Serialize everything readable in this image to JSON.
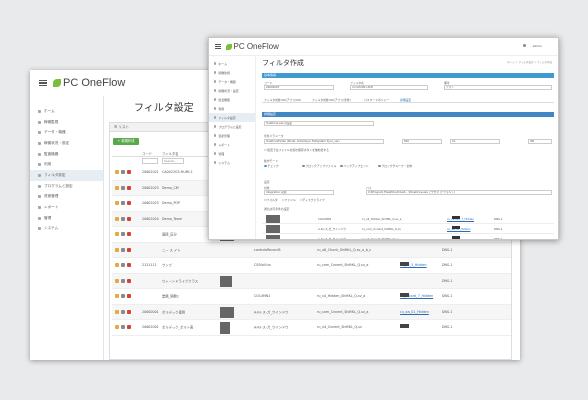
{
  "brand": {
    "name": "PC OneFlow",
    "leaf_color": "#79bf3a",
    "accent": "#3f9bd1",
    "add_button_color": "#59a94b"
  },
  "back": {
    "title": "フィルタ設定",
    "sidebar": [
      "ホーム",
      "稼働監視",
      "データ・機器",
      "稼働状況・設定",
      "監査機器",
      "利用",
      "フィルタ設定",
      "プログラムと設定",
      "資産管理",
      "レポート",
      "管理",
      "システム"
    ],
    "panel_header": "リスト",
    "add_button": "新規作成",
    "columns": [
      "",
      "コード",
      "フィルタ名"
    ],
    "search_placeholder": "Search...",
    "rows": [
      {
        "code": "20602021",
        "name": "CA0023G3-HUMI-1"
      },
      {
        "code": "20602023",
        "name": "Demo_CM"
      },
      {
        "code": "20602023",
        "name": "Demo_POP"
      },
      {
        "code": "20602024",
        "name": "Demo_Team"
      },
      {
        "code": "",
        "name": "面接_区分"
      },
      {
        "code": "",
        "name": "ニー ス イト"
      },
      {
        "code": "2121111",
        "name": "サンプ"
      },
      {
        "code": "",
        "name": "ウィーンドライブクラス"
      },
      {
        "code": "",
        "name": "業務_開発1"
      },
      {
        "code": "20600001",
        "name": "ボルデック運用"
      },
      {
        "code": "20602001",
        "name": "ボルデック_ボルト表"
      }
    ],
    "row_cells": [
      {
        "a": "controlsRecord5",
        "b": "ru_x6_Chunk_ShiftKL_Q.sv_a_b_c",
        "c": "",
        "d": "DNS-1"
      },
      {
        "a": "CSSfoll.ho",
        "b": "ru_com_Cnnent_ShiftKL_Q.sv_a",
        "c": "cu_wt_5_Hidden",
        "d": "DNS-1"
      },
      {
        "a": "",
        "b": "",
        "c": "",
        "d": "DNS-1"
      },
      {
        "a": "COLUMN1",
        "b": "ru_x4_Hidden_ShiftKL_Q.sv_a",
        "c": "cu_record_7_Hidden",
        "d": "DNS-1"
      },
      {
        "a": "A-K-I-ス-ガ_ウインドウ",
        "b": "ru_com_Cnnent_ShiftKL_Q.sv_a",
        "c": "cu_aa_01_Hidden",
        "d": "DNS-1"
      },
      {
        "a": "A-K-I-ス-ガ_ウインドウ",
        "b": "ru_x4_Cnnent_ShiftKL_Q.sv",
        "c": "",
        "d": "DNS-1"
      }
    ]
  },
  "front": {
    "title": "フィルタ作成",
    "breadcrumb": "ホーム > フィルタ設定 > フィルタ作成",
    "user": "admin",
    "sidebar": [
      "ホーム",
      "稼働監視",
      "データ・機器",
      "稼働状況・設定",
      "監査機器",
      "利用",
      "フィルタ設定",
      "プログラムと設定",
      "資産管理",
      "レポート",
      "管理",
      "システム"
    ],
    "section1": "基本情報",
    "fields": [
      {
        "label": "コード",
        "value": "20602023"
      },
      {
        "label": "フィルタ名",
        "value": "cmd-PC001-SUE"
      },
      {
        "label": "備考",
        "value": "テスト"
      }
    ],
    "tabs": [
      "フィルタ対象(OS/アプリ/OS)",
      "フィルタ対象(OS/アプリ/条件)",
      "パスワードポリシー",
      "詳細設定"
    ],
    "section2": "詳細設定",
    "target_value": "OneDrive.exe の設定",
    "sub_label": "条件パラメータ",
    "sub_select": "OneDriveFolder (Mode: ActiveSync FileSystem Sync_ver)",
    "sub_input": "500",
    "sub_input2": "10",
    "sub_select2": "ON",
    "checkbox": "既定ではファイルを開き保存ボタンを無効化する",
    "radios_label": "動作モード",
    "radios": [
      "チェック",
      "ブロックアップファイル",
      "バックアップエンド",
      "ブロックグループ・全体"
    ],
    "section3": "設定",
    "item_label": "対象",
    "item_select": "Integration 初期",
    "path_label": "パス",
    "path_value": "C:¥Program Files¥OneDrive¥... ¥OneDrive.exe アクセス (デフォルト)",
    "checks": [
      "フォルダ",
      "ファイル",
      "ディスクドライブ"
    ],
    "result_header": "通信許可条件の設定",
    "rows": [
      {
        "a": "COLUMN1",
        "b": "ru_x4_Hidden_ShiftKL_Q.sv_a",
        "c": "cu_record_7_Hidden",
        "d": "DNS-1"
      },
      {
        "a": "A-K-I-ス-ガ_ウインドウ",
        "b": "ru_com_Cnnent_ShiftKL_Q.sv",
        "c": "cu_aa_01_Hidden",
        "d": "DNS-1"
      },
      {
        "a": "A-K-I-ス-ガ_ウインドウ",
        "b": "ru_x4_Cnnent_ShiftKL_Q.sv",
        "c": "",
        "d": "DNS-1"
      }
    ]
  }
}
